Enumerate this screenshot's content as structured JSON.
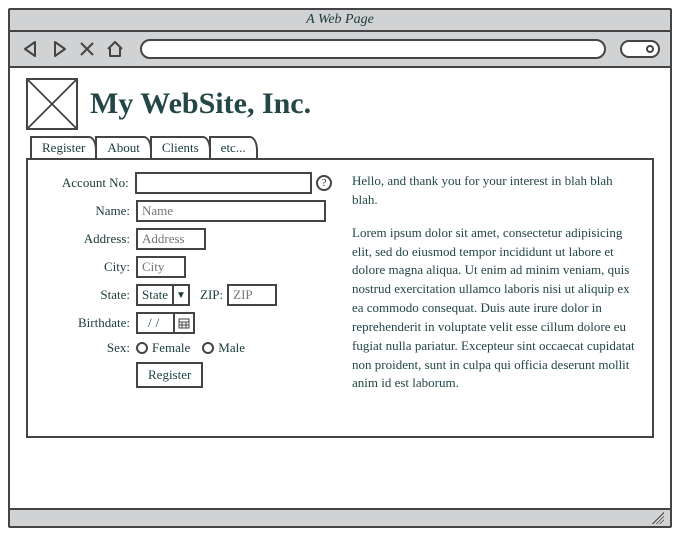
{
  "browser": {
    "title": "A Web Page"
  },
  "header": {
    "site_title": "My WebSite, Inc."
  },
  "tabs": {
    "t0": "Register",
    "t1": "About",
    "t2": "Clients",
    "t3": "etc..."
  },
  "form": {
    "labels": {
      "account_no": "Account No:",
      "name": "Name:",
      "address": "Address:",
      "city": "City:",
      "state": "State:",
      "zip": "ZIP:",
      "birthdate": "Birthdate:",
      "sex": "Sex:",
      "female": "Female",
      "male": "Male"
    },
    "placeholders": {
      "name": "Name",
      "address": "Address",
      "city": "City",
      "zip": "ZIP"
    },
    "state_selected": "State",
    "birthdate_value": "//",
    "register_button": "Register",
    "help": "?"
  },
  "body_text": {
    "p1": "Hello, and thank you for your interest in blah blah blah.",
    "p2": "Lorem ipsum dolor sit amet, consectetur adipisicing elit, sed do eiusmod tempor incididunt ut labore et dolore magna aliqua. Ut enim ad minim veniam, quis nostrud exercitation ullamco laboris nisi ut aliquip ex ea commodo consequat. Duis aute irure dolor in reprehenderit in voluptate velit esse cillum dolore eu fugiat nulla pariatur. Excepteur sint occaecat cupidatat non proident, sunt in culpa qui officia deserunt mollit anim id est laborum."
  }
}
